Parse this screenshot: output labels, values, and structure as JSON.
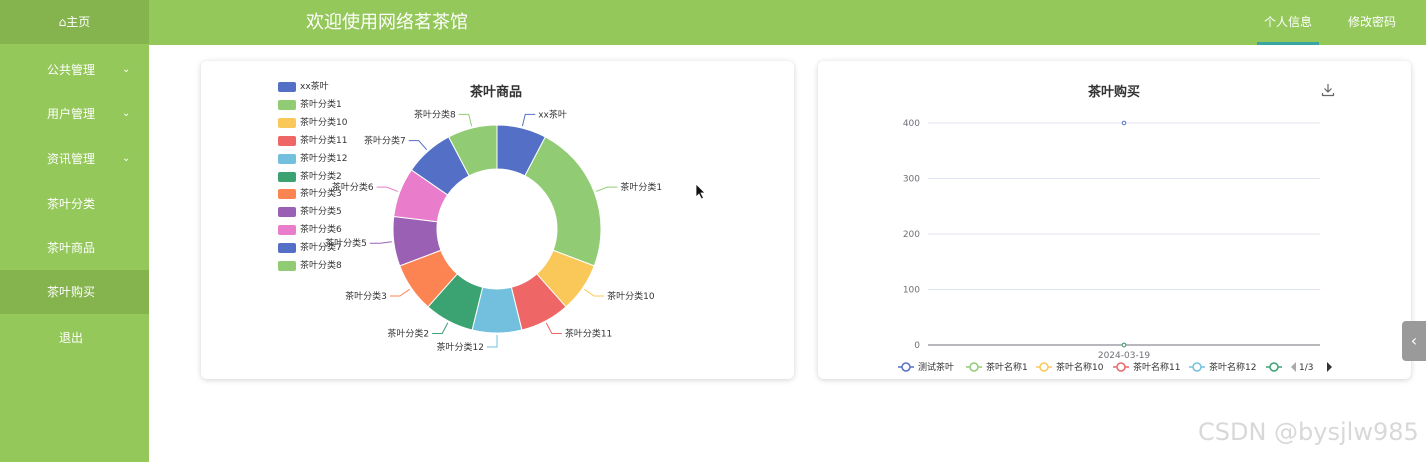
{
  "sidebar": {
    "home": "主页",
    "items": [
      {
        "label": "公共管理",
        "expandable": true
      },
      {
        "label": "用户管理",
        "expandable": true
      },
      {
        "label": "资讯管理",
        "expandable": true
      },
      {
        "label": "茶叶分类",
        "expandable": false
      },
      {
        "label": "茶叶商品",
        "expandable": false
      },
      {
        "label": "茶叶购买",
        "expandable": false
      },
      {
        "label": "退出",
        "expandable": false
      }
    ]
  },
  "header": {
    "title": "欢迎使用网络茗茶馆",
    "tabs": [
      {
        "label": "个人信息",
        "active": true
      },
      {
        "label": "修改密码",
        "active": false
      }
    ]
  },
  "colors": {
    "sidebar": "#94c85a",
    "header": "#94c85a",
    "active_tab_underline": "#3aa4a0"
  },
  "chart_data": [
    {
      "type": "pie",
      "title": "茶叶商品",
      "donut": true,
      "legend_position": "top-left",
      "labels": [
        "xx茶叶",
        "茶叶分类1",
        "茶叶分类10",
        "茶叶分类11",
        "茶叶分类12",
        "茶叶分类2",
        "茶叶分类3",
        "茶叶分类5",
        "茶叶分类6",
        "茶叶分类7",
        "茶叶分类8"
      ],
      "values": [
        1,
        3,
        1,
        1,
        1,
        1,
        1,
        1,
        1,
        1,
        1
      ],
      "colors": [
        "#5470c6",
        "#91cc75",
        "#fac858",
        "#ee6666",
        "#73c0de",
        "#3ba272",
        "#fc8452",
        "#9a60b4",
        "#ea7ccc",
        "#5470c6",
        "#91cc75"
      ]
    },
    {
      "type": "line",
      "title": "茶叶购买",
      "categories": [
        "2024-03-19"
      ],
      "ylim": [
        0,
        400
      ],
      "yticks": [
        "400",
        "300",
        "200",
        "100",
        "0"
      ],
      "grid": true,
      "legend_position": "bottom",
      "legend_page": "1/3",
      "series": [
        {
          "name": "测试茶叶",
          "values": [
            400
          ],
          "color": "#5470c6"
        },
        {
          "name": "茶叶名称1",
          "values": [
            0
          ],
          "color": "#91cc75"
        },
        {
          "name": "茶叶名称10",
          "values": [
            0
          ],
          "color": "#fac858"
        },
        {
          "name": "茶叶名称11",
          "values": [
            0
          ],
          "color": "#ee6666"
        },
        {
          "name": "茶叶名称12",
          "values": [
            0
          ],
          "color": "#73c0de"
        },
        {
          "name": "",
          "values": [
            0
          ],
          "color": "#3ba272"
        }
      ]
    }
  ],
  "watermark": "CSDN @bysjlw985"
}
